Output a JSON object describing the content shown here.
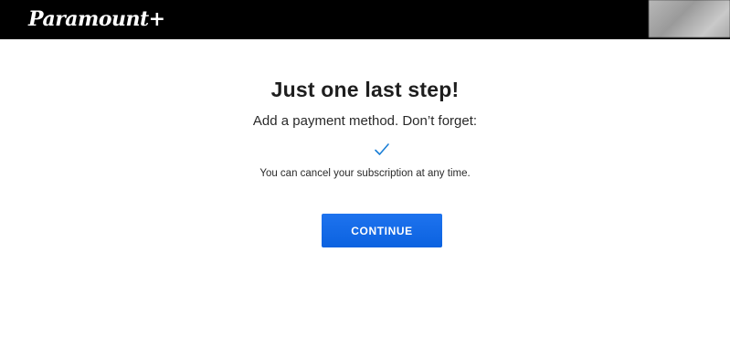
{
  "header": {
    "logo_text": "Paramount+"
  },
  "main": {
    "title": "Just one last step!",
    "subtitle": "Add a payment method. Don’t forget:",
    "check_icon": "checkmark-icon",
    "note": "You can cancel your subscription at any time.",
    "continue_label": "CONTINUE"
  },
  "colors": {
    "topbar": "#000000",
    "accent": "#0b62e0",
    "checkmark": "#1b7fd6"
  }
}
